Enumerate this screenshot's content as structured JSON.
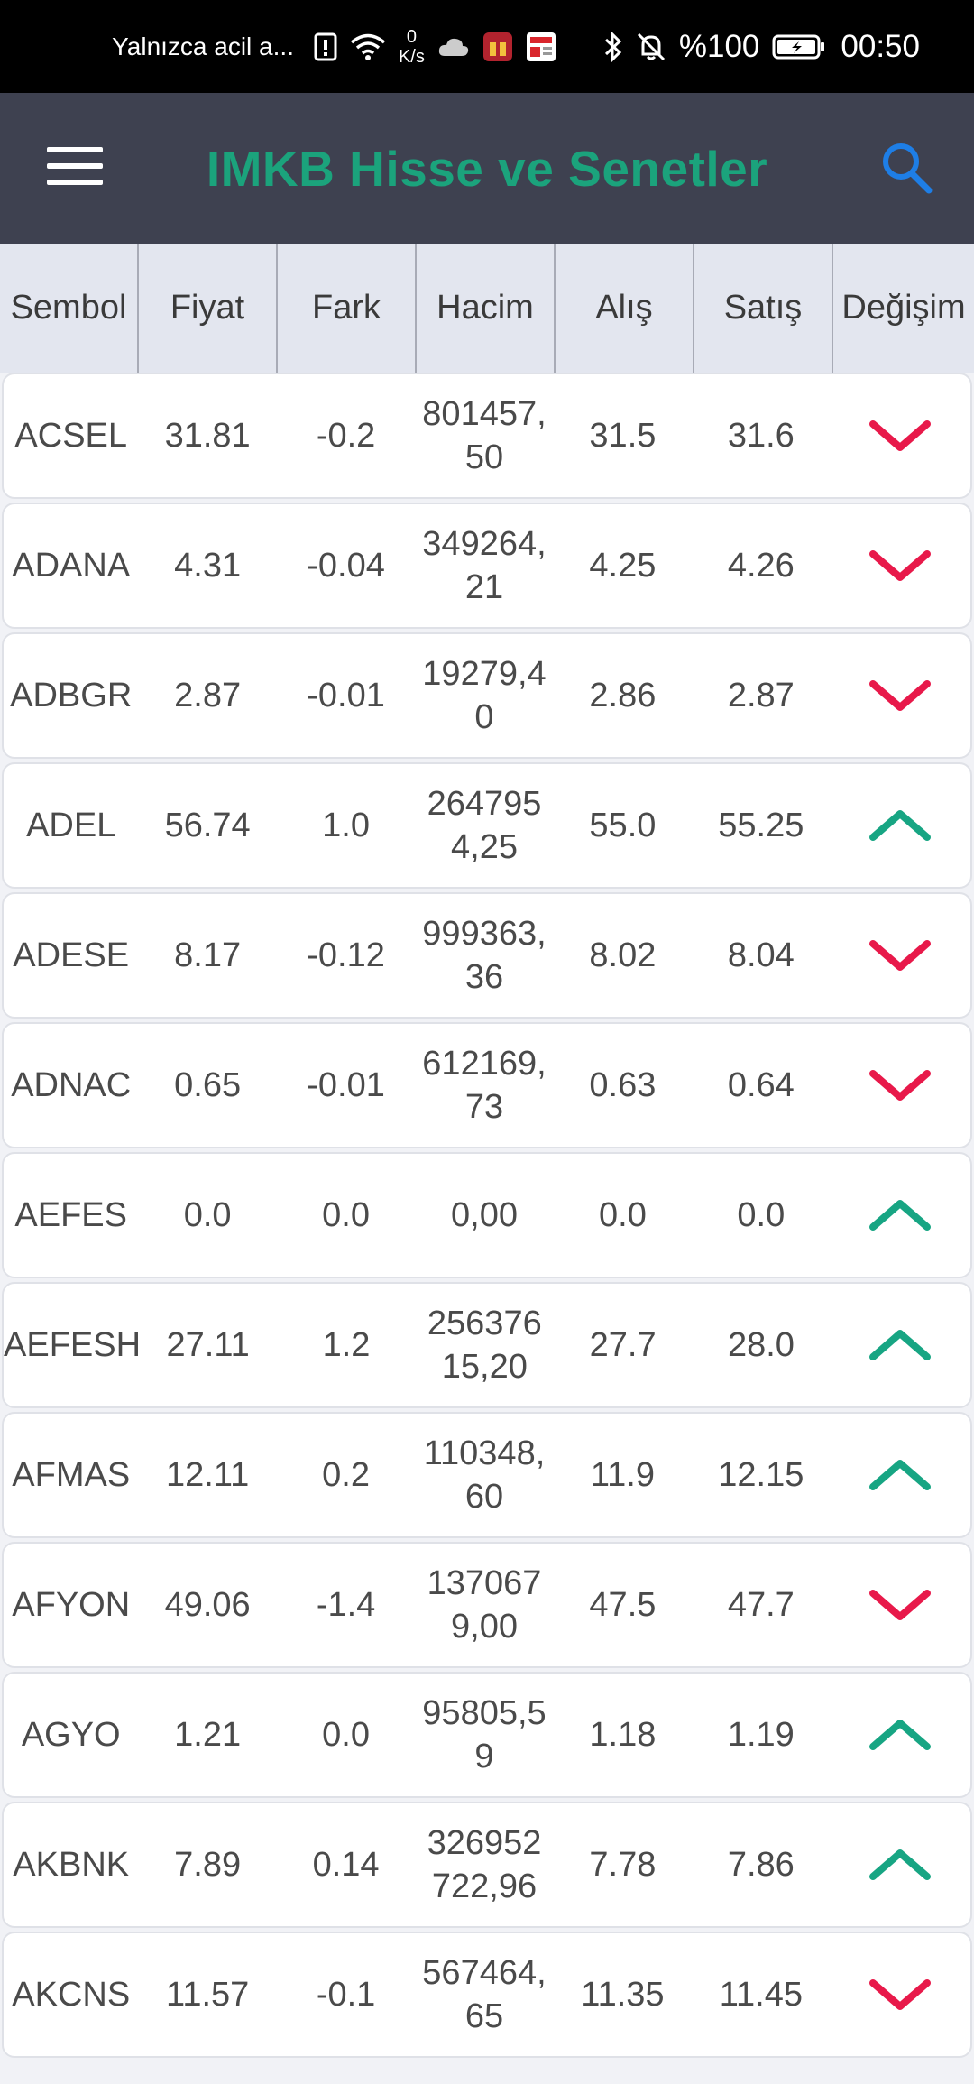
{
  "status_bar": {
    "notice": "Yalnızca acil a...",
    "speed_value": "0",
    "speed_unit": "K/s",
    "battery": "%100",
    "time": "00:50"
  },
  "app_bar": {
    "title": "IMKB Hisse ve Senetler",
    "menu_icon": "hamburger-menu-icon",
    "search_icon": "search-icon"
  },
  "table": {
    "headers": [
      "Sembol",
      "Fiyat",
      "Fark",
      "Hacim",
      "Alış",
      "Satış",
      "Değişim"
    ],
    "colors": {
      "up": "#17a583",
      "down": "#e8194a"
    },
    "rows": [
      {
        "symbol": "ACSEL",
        "price": "31.81",
        "diff": "-0.2",
        "volume": "801457,\n50",
        "bid": "31.5",
        "ask": "31.6",
        "trend": "down"
      },
      {
        "symbol": "ADANA",
        "price": "4.31",
        "diff": "-0.04",
        "volume": "349264,\n21",
        "bid": "4.25",
        "ask": "4.26",
        "trend": "down"
      },
      {
        "symbol": "ADBGR",
        "price": "2.87",
        "diff": "-0.01",
        "volume": "19279,4\n0",
        "bid": "2.86",
        "ask": "2.87",
        "trend": "down"
      },
      {
        "symbol": "ADEL",
        "price": "56.74",
        "diff": "1.0",
        "volume": "264795\n4,25",
        "bid": "55.0",
        "ask": "55.25",
        "trend": "up"
      },
      {
        "symbol": "ADESE",
        "price": "8.17",
        "diff": "-0.12",
        "volume": "999363,\n36",
        "bid": "8.02",
        "ask": "8.04",
        "trend": "down"
      },
      {
        "symbol": "ADNAC",
        "price": "0.65",
        "diff": "-0.01",
        "volume": "612169,\n73",
        "bid": "0.63",
        "ask": "0.64",
        "trend": "down"
      },
      {
        "symbol": "AEFES",
        "price": "0.0",
        "diff": "0.0",
        "volume": "0,00",
        "bid": "0.0",
        "ask": "0.0",
        "trend": "up"
      },
      {
        "symbol": "AEFESH",
        "price": "27.11",
        "diff": "1.2",
        "volume": "256376\n15,20",
        "bid": "27.7",
        "ask": "28.0",
        "trend": "up"
      },
      {
        "symbol": "AFMAS",
        "price": "12.11",
        "diff": "0.2",
        "volume": "110348,\n60",
        "bid": "11.9",
        "ask": "12.15",
        "trend": "up"
      },
      {
        "symbol": "AFYON",
        "price": "49.06",
        "diff": "-1.4",
        "volume": "137067\n9,00",
        "bid": "47.5",
        "ask": "47.7",
        "trend": "down"
      },
      {
        "symbol": "AGYO",
        "price": "1.21",
        "diff": "0.0",
        "volume": "95805,5\n9",
        "bid": "1.18",
        "ask": "1.19",
        "trend": "up"
      },
      {
        "symbol": "AKBNK",
        "price": "7.89",
        "diff": "0.14",
        "volume": "326952\n722,96",
        "bid": "7.78",
        "ask": "7.86",
        "trend": "up"
      },
      {
        "symbol": "AKCNS",
        "price": "11.57",
        "diff": "-0.1",
        "volume": "567464,\n65",
        "bid": "11.35",
        "ask": "11.45",
        "trend": "down"
      }
    ]
  }
}
